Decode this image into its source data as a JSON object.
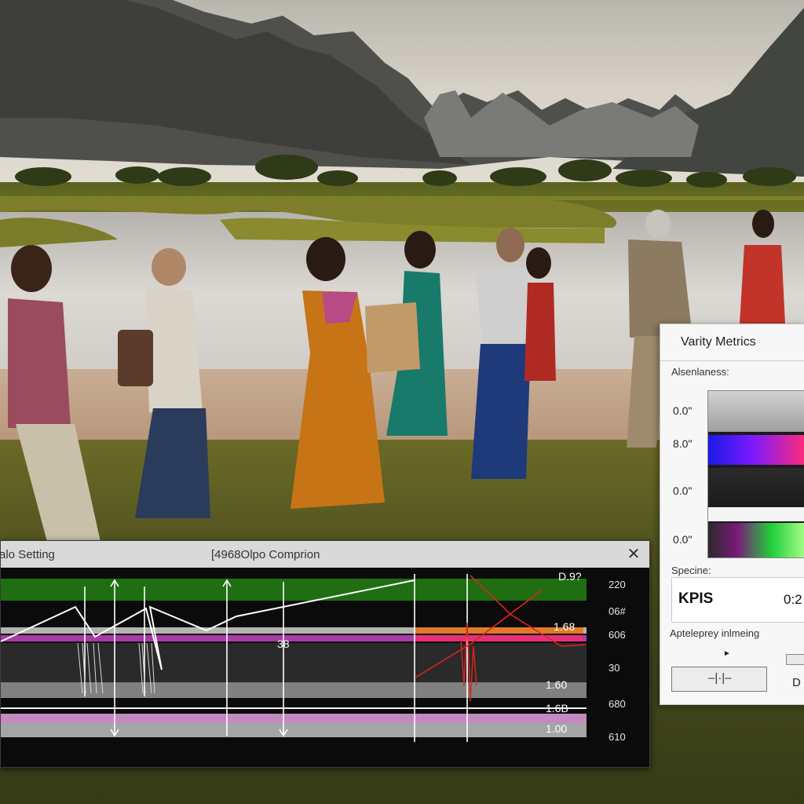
{
  "comparison_panel": {
    "left_title": "alo Setting",
    "center_title": "[4968Olpo Comprion",
    "close_icon": "close-icon",
    "chart_data": {
      "type": "line",
      "title": "[4968Olpo Comprion",
      "right_axis_ticks": [
        "220",
        "06#",
        "606",
        "30",
        "680",
        "610"
      ],
      "inline_labels": [
        "D.9?",
        "1.68",
        "38",
        "1.60",
        "1.6B",
        "1.00"
      ],
      "bands": [
        {
          "color": "#1f6e12"
        },
        {
          "color": "#b3b3b3"
        },
        {
          "color": "#a93aa8"
        },
        {
          "color": "#2a2a2a"
        },
        {
          "color": "#808080"
        },
        {
          "color": "#c38ac1"
        },
        {
          "color": "#a5a5a5"
        }
      ],
      "series": [
        {
          "color": "#ffffff"
        },
        {
          "color": "#e0231f"
        }
      ],
      "grid": false
    }
  },
  "metrics_panel": {
    "title": "Varity Metrics",
    "awareness_label": "Alsenlaness:",
    "axis_values": [
      "0.0\"",
      "8.0\"",
      "0.0\"",
      "0.0\""
    ],
    "speed_label": "Specine:",
    "kpis_label": "KPIS",
    "kpis_value": "0:2",
    "apt_label": "Apteleprey inlmeing",
    "stepper_glyph": "–|·|–",
    "side_value": "D",
    "swatch_colors": [
      "#bdbdbd",
      "#4a1aff",
      "#222222",
      "#f4f4f4",
      "#1fcf3a"
    ]
  }
}
